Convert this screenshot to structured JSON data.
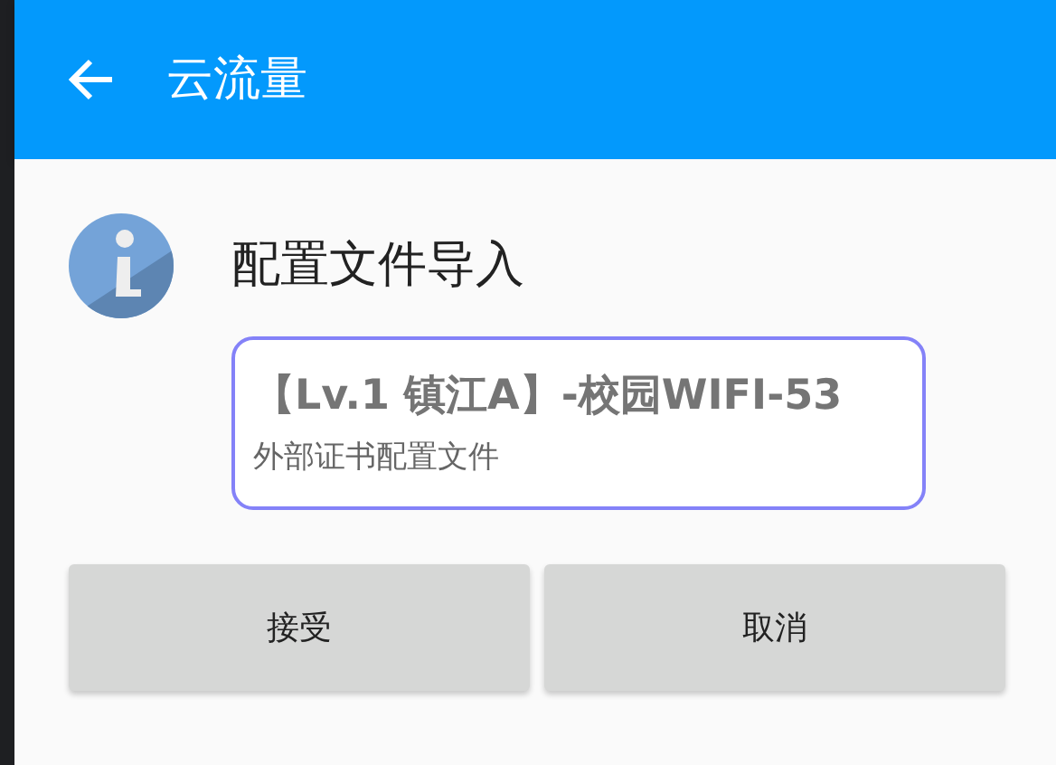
{
  "app_bar": {
    "title": "云流量"
  },
  "dialog": {
    "title": "配置文件导入",
    "profile": {
      "name": "【Lv.1 镇江A】-校园WIFI-53",
      "description": "外部证书配置文件"
    },
    "buttons": [
      {
        "label": "接受"
      },
      {
        "label": "取消"
      }
    ]
  }
}
